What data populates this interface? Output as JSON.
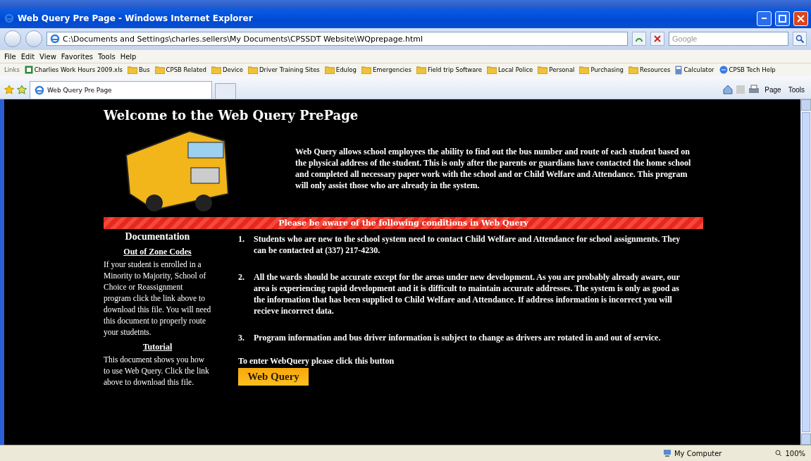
{
  "window": {
    "title": "Web Query Pre Page - Windows Internet Explorer"
  },
  "address_bar": {
    "url": "C:\\Documents and Settings\\charles.sellers\\My Documents\\CPSSDT Website\\WQprepage.html",
    "search_placeholder": "Google"
  },
  "menu": [
    "File",
    "Edit",
    "View",
    "Favorites",
    "Tools",
    "Help"
  ],
  "links": {
    "label": "Links",
    "items": [
      {
        "label": "Charlies Work Hours 2009.xls",
        "kind": "file"
      },
      {
        "label": "Bus",
        "kind": "folder"
      },
      {
        "label": "CPSB Related",
        "kind": "folder"
      },
      {
        "label": "Device",
        "kind": "folder"
      },
      {
        "label": "Driver Training Sites",
        "kind": "folder"
      },
      {
        "label": "Edulog",
        "kind": "folder"
      },
      {
        "label": "Emergencies",
        "kind": "folder"
      },
      {
        "label": "Field trip Software",
        "kind": "folder"
      },
      {
        "label": "Local Police",
        "kind": "folder"
      },
      {
        "label": "Personal",
        "kind": "folder"
      },
      {
        "label": "Purchasing",
        "kind": "folder"
      },
      {
        "label": "Resources",
        "kind": "folder"
      },
      {
        "label": "Calculator",
        "kind": "app"
      },
      {
        "label": "CPSB Tech Help",
        "kind": "web"
      }
    ]
  },
  "tabs": [
    {
      "label": "Web Query Pre Page",
      "selected": true
    }
  ],
  "command_bar": [
    "Page",
    "Tools"
  ],
  "page": {
    "heading": "Welcome to the Web Query PrePage",
    "intro": "Web Query allows school employees the ability to find out the bus number and route of each student based on the physical address of the student. This is only after the parents or guardians have contacted the home school and completed all necessary paper work with the school and or Child Welfare and Attendance. This program will only assist those who are already in the system.",
    "banner": "Please be aware of the following conditions in Web Query",
    "documentation": {
      "title": "Documentation",
      "sections": [
        {
          "link": "Out of Zone Codes",
          "text": "If your student is enrolled in a Minority to Majority, School of Choice or Reassignment program click the link above to download this file. You will need this document to properly route your studetnts."
        },
        {
          "link": "Tutorial",
          "text": "This document shows you how to use Web Query. Click the link above to download this file."
        }
      ]
    },
    "conditions": [
      {
        "number": "1.",
        "text": "Students who are new to the school system need to contact Child Welfare and Attendance for school assignments. They can be contacted at (337) 217-4230."
      },
      {
        "number": "2.",
        "text": "All the wards should be accurate except for the areas under new development. As you are probably already aware, our area is experiencing rapid development and it is difficult to maintain accurate addresses. The system is only as good as the information that has been supplied to Child Welfare and Attendance. If address information is incorrect you will recieve incorrect data."
      },
      {
        "number": "3.",
        "text": "Program information and bus driver information is subject to change as drivers are rotated in and out of service."
      }
    ],
    "enter_prompt": "To enter WebQuery please click this button",
    "enter_button": "Web Query"
  },
  "status_bar": {
    "zone": "My Computer",
    "zoom": "100%"
  }
}
